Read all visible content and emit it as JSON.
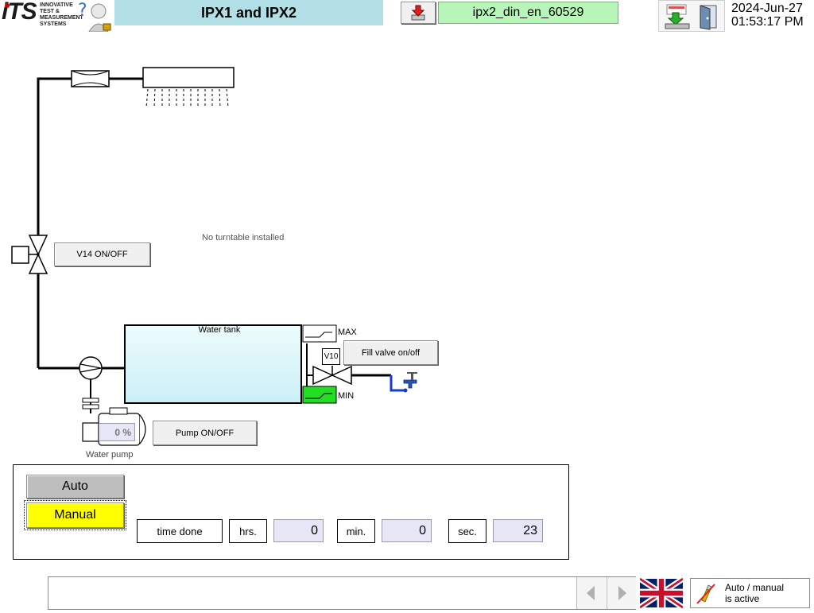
{
  "header": {
    "logo_text": "iTS",
    "logo_lines": [
      "INNOVATIVE",
      "TEST &",
      "MEASUREMENT",
      "SYSTEMS"
    ],
    "title": "IPX1 and IPX2",
    "recipe": "ipx2_din_en_60529",
    "date": "2024-Jun-27",
    "time": "01:53:17 PM"
  },
  "diagram": {
    "no_turntable": "No turntable installed",
    "v14_button": "V14 ON/OFF",
    "water_tank": "Water tank",
    "max_label": "MAX",
    "min_label": "MIN",
    "v10_label": "V10",
    "fill_valve_button": "Fill valve on/off",
    "pump_percent": "0 %",
    "pump_button": "Pump ON/OFF",
    "pump_label": "Water pump"
  },
  "panel": {
    "auto_label": "Auto",
    "manual_label": "Manual",
    "time_done_label": "time done",
    "hrs_label": "hrs.",
    "hrs_value": "0",
    "min_label": "min.",
    "min_value": "0",
    "sec_label": "sec.",
    "sec_value": "23"
  },
  "footer": {
    "auto_manual_line1": "Auto / manual",
    "auto_manual_line2": "is active"
  },
  "colors": {
    "title_bg": "#b1dfe5",
    "recipe_bg": "#b8f5b8",
    "manual_active": "#ffff00",
    "min_switch_active": "#22dd22",
    "tank_fill": "#dff7fb"
  }
}
